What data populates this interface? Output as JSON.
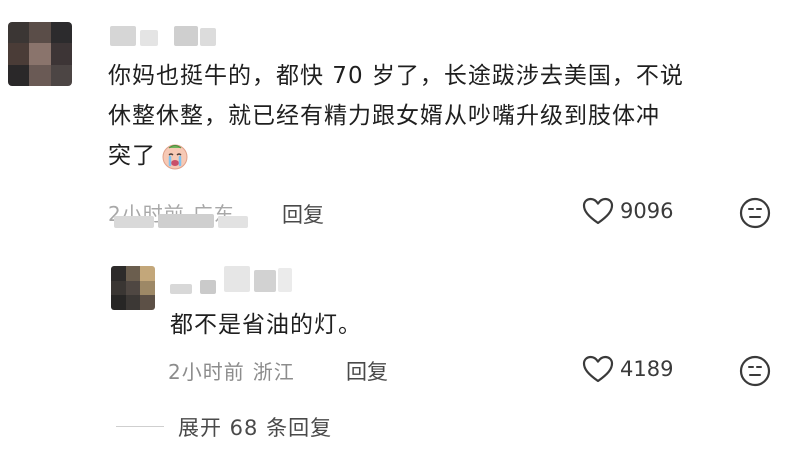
{
  "comments": [
    {
      "text": "你妈也挺牛的，都快70岁了，长途跋涉去美国，不说休整休整，就已经有精力跟女婿从吵嘴升级到肢体冲突了",
      "line1": "你妈也挺牛的，都快 70 岁了，长途跋涉去美国，不说",
      "line2": "休整休整，就已经有精力跟女婿从吵嘴升级到肢体冲",
      "line3": "突了",
      "emoji_icon": "crying-face-icon",
      "time": "2小时前",
      "location": "广东",
      "reply_label": "回复",
      "likes": "9096"
    },
    {
      "text": "都不是省油的灯。",
      "time": "2小时前",
      "location": "浙江",
      "reply_label": "回复",
      "likes": "4189"
    }
  ],
  "expand_replies": "展开 68 条回复",
  "colors": {
    "text": "#1f1f1f",
    "meta": "#8c8c8c",
    "icon": "#3a3a3a"
  }
}
